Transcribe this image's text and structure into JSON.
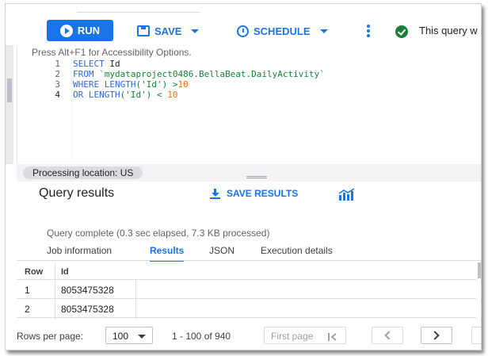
{
  "toolbar": {
    "run_label": "RUN",
    "save_label": "SAVE",
    "schedule_label": "SCHEDULE",
    "status_text": "This query w"
  },
  "editor": {
    "accessibility_hint": "Press Alt+F1 for Accessibility Options.",
    "line_numbers": [
      "1",
      "2",
      "3",
      "4"
    ],
    "lines": [
      {
        "kw": "SELECT",
        "rest": " Id"
      },
      {
        "kw": "FROM",
        "str": " `mydataproject0486.BellaBeat.DailyActivity`"
      },
      {
        "kw": "WHERE LENGTH",
        "rest": "('Id') >",
        "num": "10"
      },
      {
        "kw": "OR LENGTH",
        "rest": "('Id') < ",
        "num": "10"
      }
    ]
  },
  "processing": {
    "location_text": "Processing location: US"
  },
  "results": {
    "title": "Query results",
    "save_results_label": "SAVE RESULTS",
    "complete_text": "Query complete (0.3 sec elapsed, 7.3 KB processed)",
    "tabs": [
      "Job information",
      "Results",
      "JSON",
      "Execution details"
    ],
    "active_tab": "Results",
    "columns": [
      "Row",
      "Id"
    ],
    "rows": [
      [
        "1",
        "8053475328"
      ],
      [
        "2",
        "8053475328"
      ]
    ]
  },
  "pagination": {
    "rows_per_page_label": "Rows per page:",
    "rows_per_page_value": "100",
    "range_text": "1 - 100 of 940",
    "first_page_label": "First page"
  },
  "colors": {
    "primary": "#1a73e8",
    "success": "#188038",
    "keyword": "#3367d6",
    "number": "#e8710a"
  }
}
